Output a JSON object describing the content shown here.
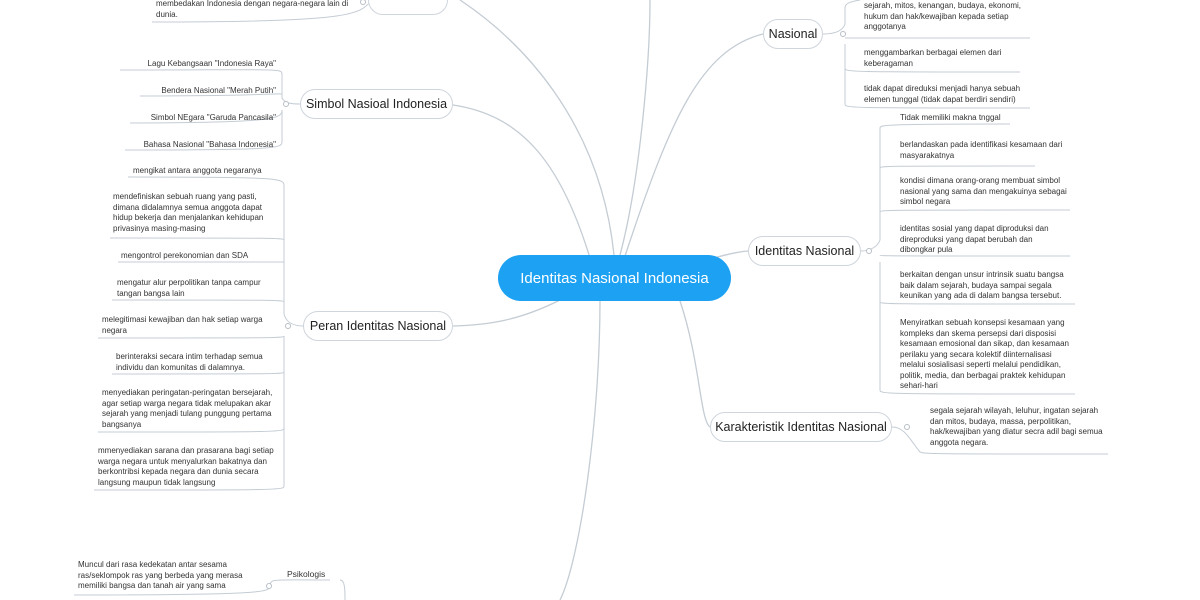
{
  "central": {
    "title": "Identitas Nasional Indonesia"
  },
  "branches": {
    "top_left": {
      "title": "",
      "items": [
        "membedakan Indonesia dengan negara-negara lain di dunia."
      ]
    },
    "simbol": {
      "title": "Simbol Nasioal Indonesia",
      "items": [
        "Lagu Kebangsaan \"Indonesia Raya\"",
        "Bendera Nasional \"Merah Putih\"",
        "Simbol NEgara \"Garuda Pancasila\"",
        "Bahasa Nasional \"Bahasa Indonesia\""
      ]
    },
    "peran": {
      "title": "Peran Identitas Nasional",
      "items": [
        "mengikat antara anggota negaranya",
        "mendefiniskan sebuah ruang yang pasti, dimana didalamnya semua anggota dapat hidup bekerja dan menjalankan kehidupan privasinya masing-masing",
        "mengontrol perekonomian dan SDA",
        "mengatur alur perpolitikan tanpa campur tangan bangsa lain",
        "melegitimasi kewajiban dan hak setiap warga negara",
        "berinteraksi secara intim terhadap semua individu dan komunitas di dalamnya.",
        "menyediakan peringatan-peringatan bersejarah, agar setiap warga negara tidak melupakan akar sejarah yang menjadi tulang punggung pertama bangsanya",
        "mmenyediakan sarana dan prasarana bagi setiap warga negara untuk menyalurkan bakatnya dan berkontribsi kepada negara dan dunia secara langsung maupun tidak langsung"
      ]
    },
    "bottom_left": {
      "sub": "Psikologis",
      "items": [
        "Muncul dari rasa kedekatan antar sesama ras/seklompok ras yang berbeda yang merasa memiliki bangsa dan tanah air yang sama"
      ]
    },
    "nasional": {
      "title": "Nasional",
      "items": [
        "sejarah, mitos, kenangan, budaya, ekonomi, hukum dan hak/kewajiban kepada setiap anggotanya",
        "menggambarkan berbagai elemen dari keberagaman",
        "tidak dapat direduksi menjadi hanya sebuah elemen tunggal (tidak dapat berdiri sendiri)"
      ]
    },
    "identitas": {
      "title": "Identitas Nasional",
      "items": [
        "Tidak memiliki makna tnggal",
        "berlandaskan pada identifikasi kesamaan dari masyarakatnya",
        "kondisi dimana orang-orang membuat simbol nasional yang sama dan mengakuinya sebagai simbol negara",
        "identitas sosial yang dapat diproduksi dan direproduksi yang dapat berubah dan dibongkar pula",
        "berkaitan dengan unsur intrinsik suatu bangsa baik dalam sejarah, budaya sampai segala keunikan yang ada di dalam bangsa tersebut.",
        "Menyiratkan sebuah konsepsi kesamaan yang kompleks dan skema persepsi dari disposisi kesamaan emosional dan sikap, dan kesamaan perilaku yang secara kolektif diinternalisasi melalui sosialisasi seperti melalui pendidikan, politik, media, dan berbagai praktek kehidupan sehari-hari"
      ]
    },
    "karakteristik": {
      "title": "Karakteristik Identitas Nasional",
      "items": [
        "segala sejarah wilayah, leluhur, ingatan sejarah dan mitos, budaya, massa, perpolitikan, hak/kewajiban yang diatur secra adil bagi semua anggota negara."
      ]
    }
  },
  "colors": {
    "central_bg": "#1da1f2",
    "line": "#c4ccd4",
    "topic_border": "#cfd5dc"
  }
}
